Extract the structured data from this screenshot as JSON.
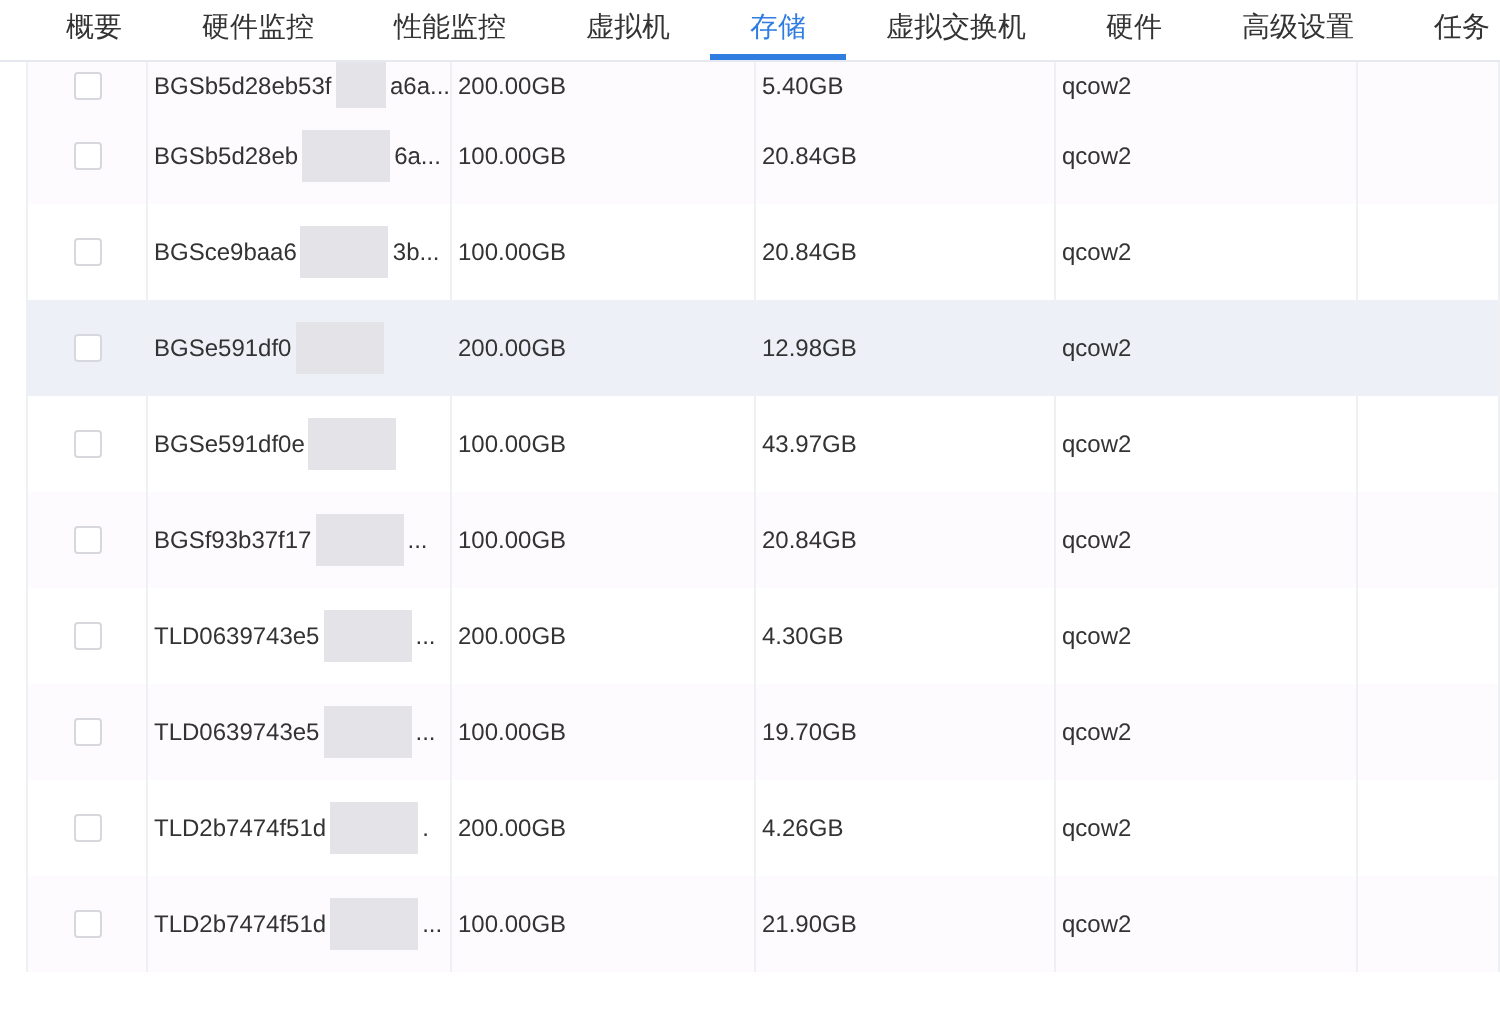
{
  "tabs": [
    {
      "label": "概要",
      "selected": false
    },
    {
      "label": "硬件监控",
      "selected": false
    },
    {
      "label": "性能监控",
      "selected": false
    },
    {
      "label": "虚拟机",
      "selected": false
    },
    {
      "label": "存储",
      "selected": true
    },
    {
      "label": "虚拟交换机",
      "selected": false
    },
    {
      "label": "硬件",
      "selected": false
    },
    {
      "label": "高级设置",
      "selected": false
    },
    {
      "label": "任务",
      "selected": false
    }
  ],
  "table": {
    "rows": [
      {
        "checked": false,
        "hovered": false,
        "name": "BGSb5d28eb53f",
        "name_tail": "a6a...",
        "capacity": "200.00GB",
        "used": "5.40GB",
        "format": "qcow2"
      },
      {
        "checked": false,
        "hovered": false,
        "name": "BGSb5d28eb",
        "name_tail": "6a...",
        "capacity": "100.00GB",
        "used": "20.84GB",
        "format": "qcow2"
      },
      {
        "checked": false,
        "hovered": false,
        "name": "BGSce9baa6",
        "name_tail": "3b...",
        "capacity": "100.00GB",
        "used": "20.84GB",
        "format": "qcow2"
      },
      {
        "checked": false,
        "hovered": true,
        "name": "BGSe591df0",
        "capacity": "200.00GB",
        "used": "12.98GB",
        "format": "qcow2"
      },
      {
        "checked": false,
        "hovered": false,
        "name": "BGSe591df0e",
        "capacity": "100.00GB",
        "used": "43.97GB",
        "format": "qcow2"
      },
      {
        "checked": false,
        "hovered": false,
        "name": "BGSf93b37f17",
        "name_tail": "...",
        "capacity": "100.00GB",
        "used": "20.84GB",
        "format": "qcow2"
      },
      {
        "checked": false,
        "hovered": false,
        "name": "TLD0639743e5",
        "name_tail": "...",
        "capacity": "200.00GB",
        "used": "4.30GB",
        "format": "qcow2"
      },
      {
        "checked": false,
        "hovered": false,
        "name": "TLD0639743e5",
        "name_tail": "...",
        "capacity": "100.00GB",
        "used": "19.70GB",
        "format": "qcow2"
      },
      {
        "checked": false,
        "hovered": false,
        "name": "TLD2b7474f51d",
        "name_tail": ".",
        "capacity": "200.00GB",
        "used": "4.26GB",
        "format": "qcow2"
      },
      {
        "checked": false,
        "hovered": false,
        "name": "TLD2b7474f51d",
        "name_tail": "...",
        "capacity": "100.00GB",
        "used": "21.90GB",
        "format": "qcow2"
      }
    ]
  }
}
